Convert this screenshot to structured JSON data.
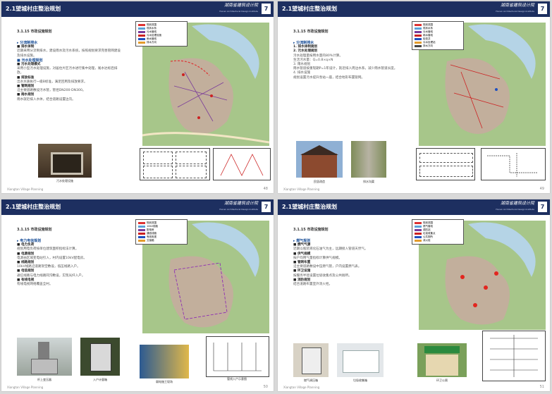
{
  "pages": [
    {
      "header_title": "2.1望城村庄整治规划",
      "logo": "湖南省建筑设计院",
      "logo_sub": "Hunan Architectural Design Institute",
      "page_no": "7",
      "section": "3.1.15 市政设施规划",
      "body": [
        {
          "k": "h",
          "t": "▸ 分流制排水"
        },
        {
          "k": "b",
          "t": "■ 排水体制"
        },
        {
          "k": "d",
          "t": "近期采用分流制排水，建设雨水及污水系统，按照规划要求完善管网建设及排水设施。"
        },
        {
          "k": "h",
          "t": "■ 污水处理规划"
        },
        {
          "k": "b",
          "t": "■ 污水处理模式"
        },
        {
          "k": "d",
          "t": "采用小型污水处理设施，对居住片区污水进行集中处理，尾水达标后排放。"
        },
        {
          "k": "b",
          "t": "■ 排放标准"
        },
        {
          "k": "d",
          "t": "出水水质执行一级B标准，满足回用及排放要求。"
        },
        {
          "k": "b",
          "t": "■ 管网规划"
        },
        {
          "k": "d",
          "t": "沿主要道路敷设污水管，管径DN200-DN300。"
        },
        {
          "k": "b",
          "t": "■ 雨水规划"
        },
        {
          "k": "d",
          "t": "雨水就近排入水体，结合道路设置边沟。"
        }
      ],
      "photo_captions": [
        "污水处理设施"
      ],
      "footer": "Xiangtan Village Planning",
      "footer_page": "48"
    },
    {
      "header_title": "2.1望城村庄整治规划",
      "logo": "湖南省建筑设计院",
      "logo_sub": "Hunan Architectural Design Institute",
      "page_no": "7",
      "section": "3.1.15 市政设施规划",
      "body": [
        {
          "k": "h",
          "t": "▸ 分流制排水"
        },
        {
          "k": "b",
          "t": "1. 排水体制规划"
        },
        {
          "k": "b",
          "t": "2. 污水处理规划"
        },
        {
          "k": "d",
          "t": "污水处理量按用水量的80%计算。"
        },
        {
          "k": "d",
          "t": "生活污水量：Q=0.8×q×N"
        },
        {
          "k": "d",
          "t": "3. 雨水规划"
        },
        {
          "k": "d",
          "t": "雨水管道按重现期P=1年设计，就近排入周边水系，减少雨水管道长度。"
        },
        {
          "k": "d",
          "t": "4. 排水设施"
        },
        {
          "k": "d",
          "t": "规划设置污水提升泵站一座，结合地形布置管网。"
        }
      ],
      "photo_captions": [
        "民居改造",
        "排水沟渠"
      ],
      "footer": "Xiangtan Village Planning",
      "footer_page": "49"
    },
    {
      "header_title": "2.1望城村庄整治规划",
      "logo": "湖南省建筑设计院",
      "logo_sub": "Hunan Architectural Design Institute",
      "page_no": "7",
      "section": "3.1.15 市政设施规划",
      "body": [
        {
          "k": "h",
          "t": "▸ 电力电信规划"
        },
        {
          "k": "b",
          "t": "■ 电力负荷"
        },
        {
          "k": "d",
          "t": "规划用电负荷按单位建筑面积指标法计算。"
        },
        {
          "k": "b",
          "t": "■ 电源规划"
        },
        {
          "k": "d",
          "t": "电源由区域变电站引入，村内设置10kV配电房。"
        },
        {
          "k": "b",
          "t": "■ 线路规划"
        },
        {
          "k": "d",
          "t": "10kV线路沿道路架空敷设，低压线路入户。"
        },
        {
          "k": "b",
          "t": "■ 电信规划"
        },
        {
          "k": "d",
          "t": "通信线路与电力线路同沟敷设，实现光纤入户。"
        },
        {
          "k": "b",
          "t": "■ 有线电视"
        },
        {
          "k": "d",
          "t": "有线电视网络覆盖全村。"
        }
      ],
      "photo_captions": [
        "杆上变压器",
        "入户计量箱",
        "弱电施工现场",
        "管线入户示意图"
      ],
      "footer": "Xiangtan Village Planning",
      "footer_page": "50"
    },
    {
      "header_title": "2.1望城村庄整治规划",
      "logo": "湖南省建筑设计院",
      "logo_sub": "Hunan Architectural Design Institute",
      "page_no": "7",
      "section": "3.1.15 市政设施规划",
      "body": [
        {
          "k": "h",
          "t": "▸ 燃气规划"
        },
        {
          "k": "b",
          "t": "■ 燃气气源"
        },
        {
          "k": "d",
          "t": "近期以瓶装液化石油气为主，远期接入管道天然气。"
        },
        {
          "k": "b",
          "t": "■ 供气规模"
        },
        {
          "k": "d",
          "t": "按户均用气量指标计算供气规模。"
        },
        {
          "k": "b",
          "t": "■ 管网布置"
        },
        {
          "k": "d",
          "t": "沿主要道路敷设中压燃气管，户内设置燃气表。"
        },
        {
          "k": "b",
          "t": "■ 环卫设施"
        },
        {
          "k": "d",
          "t": "按服务半径设置垃圾收集点及公共厕所。"
        },
        {
          "k": "b",
          "t": "■ 消防规划"
        },
        {
          "k": "d",
          "t": "结合道路布置室外消火栓。"
        }
      ],
      "photo_captions": [
        "燃气调压箱",
        "垃圾收集箱",
        "环卫公厕"
      ],
      "footer": "Xiangtan Village Planning",
      "footer_page": "51"
    }
  ],
  "legends": [
    [
      "规划范围",
      "现状水系",
      "污水管线",
      "污水处理设施",
      "雨水管线",
      "排水方向"
    ],
    [
      "规划范围",
      "现状水系",
      "污水管线",
      "雨水管线",
      "检查井",
      "污水处理站",
      "排水方向"
    ],
    [
      "规划范围",
      "10kV线路",
      "配电房",
      "通信线路",
      "有线电视",
      "交接箱"
    ],
    [
      "规划范围",
      "燃气管线",
      "调压站",
      "垃圾收集点",
      "公共厕所",
      "消火栓"
    ]
  ],
  "colors": {
    "header": "#1d2f60",
    "accent": "#1a4f98",
    "map_green": "#9cc07d",
    "zone_pink": "#d98b8b"
  }
}
